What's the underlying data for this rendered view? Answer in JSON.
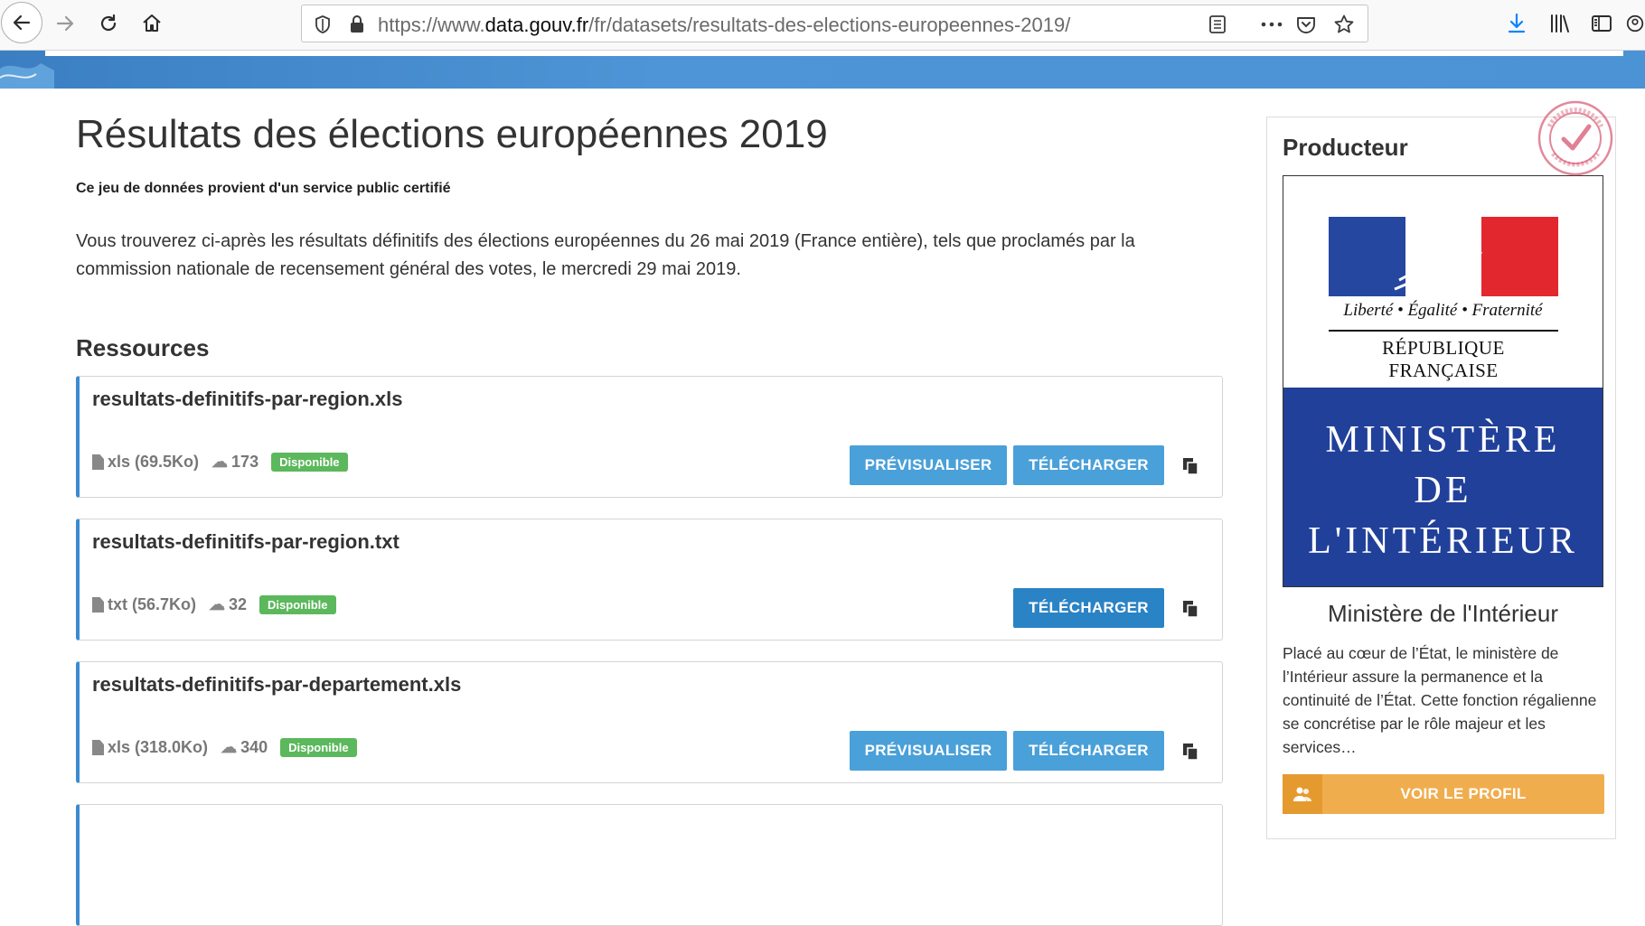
{
  "browser": {
    "url_prefix": "https://www.",
    "url_domain": "data.gouv.fr",
    "url_path": "/fr/datasets/resultats-des-elections-europeennes-2019/"
  },
  "page": {
    "title": "Résultats des élections européennes 2019",
    "certified_note": "Ce jeu de données provient d'un service public certifié",
    "description": "Vous trouverez ci-après les résultats définitifs des élections européennes du 26 mai 2019 (France entière), tels que proclamés par la commission nationale de recensement général des votes, le mercredi 29 mai 2019."
  },
  "resources": {
    "heading": "Ressources",
    "items": [
      {
        "name": "resultats-definitifs-par-region.xls",
        "format": "xls (69.5Ko)",
        "downloads": "173",
        "status": "Disponible",
        "preview_label": "PRÉVISUALISER",
        "download_label": "TÉLÉCHARGER"
      },
      {
        "name": "resultats-definitifs-par-region.txt",
        "format": "txt (56.7Ko)",
        "downloads": "32",
        "status": "Disponible",
        "download_label": "TÉLÉCHARGER"
      },
      {
        "name": "resultats-definitifs-par-departement.xls",
        "format": "xls (318.0Ko)",
        "downloads": "340",
        "status": "Disponible",
        "preview_label": "PRÉVISUALISER",
        "download_label": "TÉLÉCHARGER"
      }
    ]
  },
  "sidebar": {
    "title": "Producteur",
    "logo": {
      "motto": "Liberté • Égalité • Fraternité",
      "republic": "RÉPUBLIQUE FRANÇAISE",
      "line1": "MINISTÈRE",
      "line2": "DE",
      "line3": "L'INTÉRIEUR"
    },
    "org_name": "Ministère de l'Intérieur",
    "org_description": "Placé au cœur de l’État, le ministère de l’Intérieur assure la permanence et la continuité de l’État. Cette fonction régalienne se concrétise par le rôle majeur et les services…",
    "profile_button": "VOIR LE PROFIL"
  },
  "colors": {
    "primary_button": "#4aa0d8",
    "badge_green": "#5cb85c",
    "profile_orange": "#f0ad4e",
    "ministry_blue": "#21409a"
  }
}
